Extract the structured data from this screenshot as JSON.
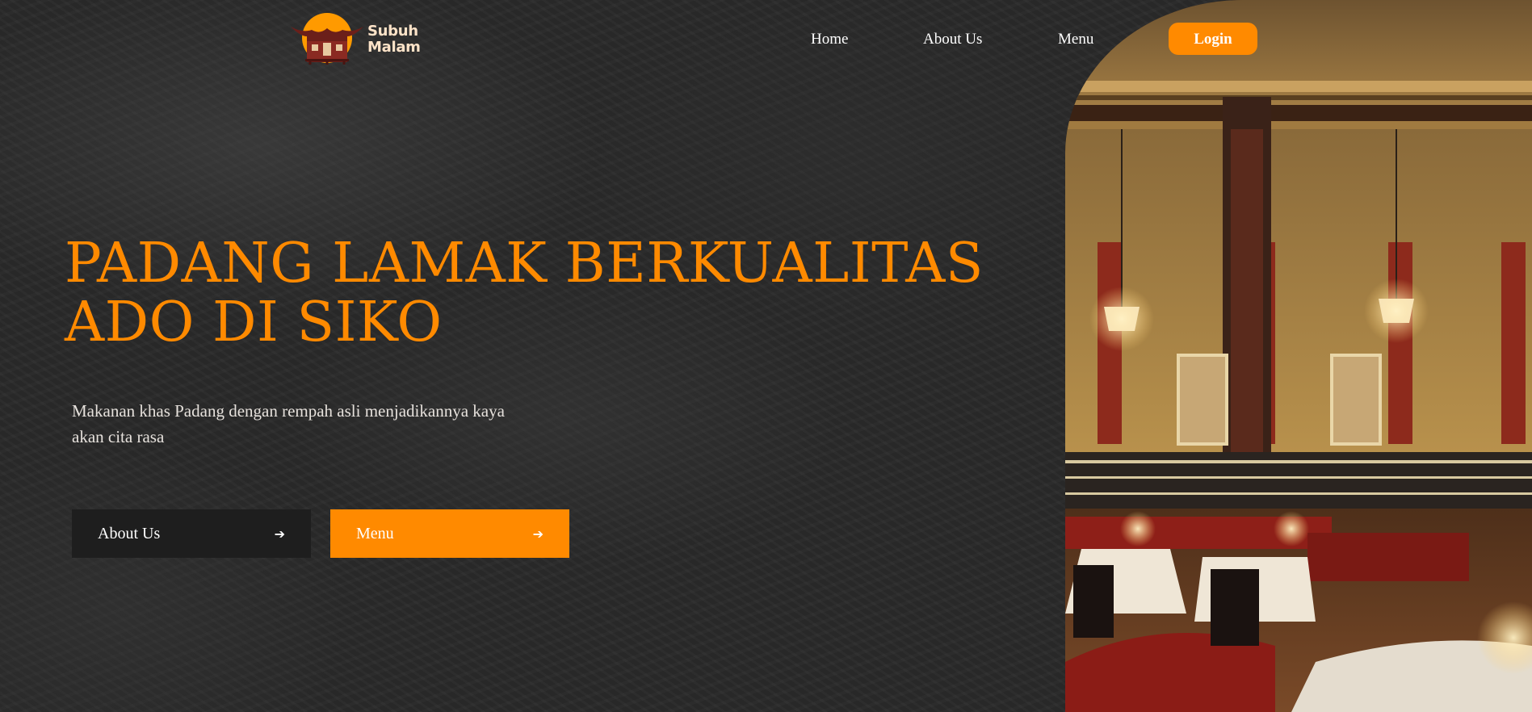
{
  "brand": {
    "name_line1": "Subuh",
    "name_line2": "Malam",
    "logo_icon": "rumah-gadang-sun-icon"
  },
  "nav": {
    "items": [
      {
        "label": "Home"
      },
      {
        "label": "About Us"
      },
      {
        "label": "Menu"
      }
    ],
    "login_label": "Login"
  },
  "hero": {
    "title_line1": "PADANG LAMAK BERKUALITAS",
    "title_line2": "ADO DI SIKO",
    "subtitle": "Makanan khas Padang dengan rempah asli menjadikannya kaya akan cita rasa",
    "buttons": [
      {
        "label": "About Us",
        "icon": "arrow-right-icon"
      },
      {
        "label": "Menu",
        "icon": "arrow-right-icon"
      }
    ]
  },
  "colors": {
    "accent": "#ff8a00",
    "background": "#2a2a2a",
    "dark_button": "#1e1e1e",
    "text_light": "#ffffff"
  }
}
